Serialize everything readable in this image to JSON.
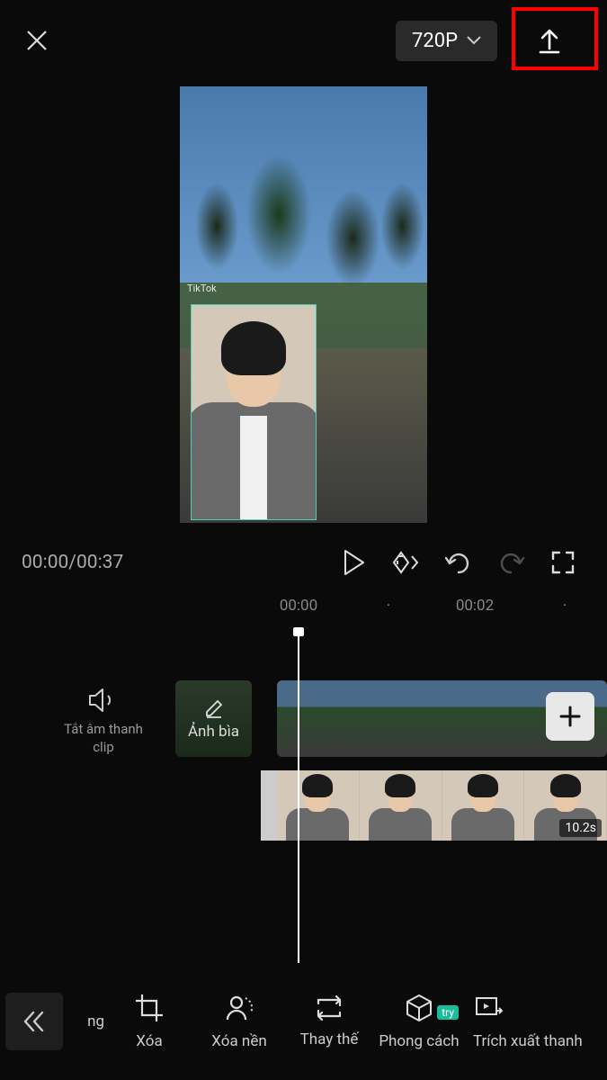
{
  "header": {
    "resolution": "720P"
  },
  "preview": {
    "watermark": "TikTok"
  },
  "playback": {
    "current_time": "00:00",
    "total_time": "00:37"
  },
  "ruler": {
    "marks": [
      "00:00",
      "·",
      "00:02",
      "·"
    ]
  },
  "timeline": {
    "mute_label": "Tắt âm thanh clip",
    "cover_label": "Ảnh bìa",
    "overlay_duration": "10.2s"
  },
  "toolbar": {
    "partial_left": "ng",
    "items": [
      {
        "label": "Xóa"
      },
      {
        "label": "Xóa nền"
      },
      {
        "label": "Thay thế"
      },
      {
        "label": "Phong cách",
        "badge": "try"
      }
    ],
    "partial_right": "Trích xuất thanh"
  }
}
